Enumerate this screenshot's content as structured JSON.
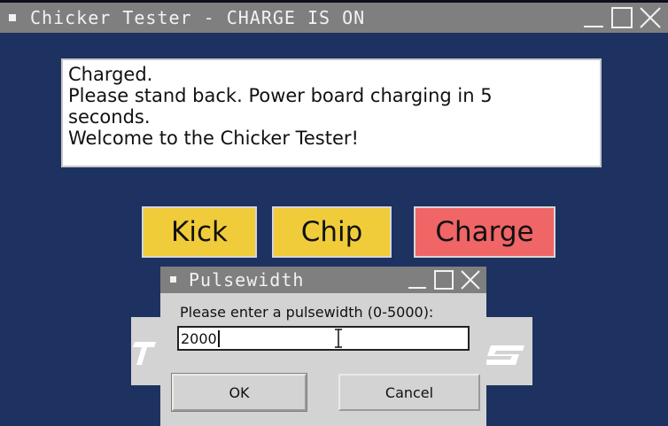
{
  "window": {
    "title": "Chicker Tester - CHARGE IS ON"
  },
  "log": {
    "lines": [
      "Charged.",
      "Please stand back. Power board charging in 5",
      "seconds.",
      "Welcome to the Chicker Tester!"
    ]
  },
  "buttons": {
    "kick": "Kick",
    "chip": "Chip",
    "charge": "Charge"
  },
  "dialog": {
    "title": "Pulsewidth",
    "prompt": "Please enter a pulsewidth (0-5000):",
    "value": "2000",
    "ok_label": "OK",
    "cancel_label": "Cancel"
  },
  "colors": {
    "background": "#1d3260",
    "titlebar": "#7f7f7f",
    "kick_chip": "#f0cc3a",
    "charge": "#f06566"
  },
  "icons": [
    "minimize-icon",
    "maximize-icon",
    "close-icon",
    "ibeam-cursor-icon"
  ]
}
